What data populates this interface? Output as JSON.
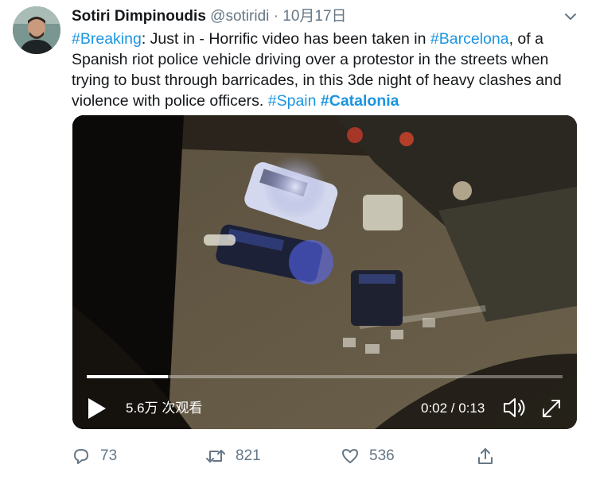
{
  "author": {
    "name": "Sotiri Dimpinoudis",
    "handle": "@sotiridi",
    "separator": "·",
    "date": "10月17日"
  },
  "tweet": {
    "hashtag_breaking": "#Breaking",
    "text_1": ": Just in - Horrific video has been taken in ",
    "hashtag_barcelona": "#Barcelona",
    "text_2": ", of a Spanish riot police vehicle driving over a protestor in the streets when trying to bust through barricades, in this 3de night of heavy clashes and violence with police officers. ",
    "hashtag_spain": "#Spain",
    "text_3": " ",
    "hashtag_catalonia": "#Catalonia"
  },
  "video": {
    "views": "5.6万 次观看",
    "time": "0:02 / 0:13",
    "progress": 0.17
  },
  "actions": {
    "replies": "73",
    "retweets": "821",
    "likes": "536"
  },
  "icons": {
    "reply": "reply-icon",
    "retweet": "retweet-icon",
    "like": "heart-icon",
    "share": "share-icon",
    "play": "play-icon",
    "volume": "volume-icon",
    "fullscreen": "fullscreen-icon",
    "more": "chevron-down-icon"
  },
  "colors": {
    "link": "#1b95e0",
    "muted": "#657786"
  }
}
